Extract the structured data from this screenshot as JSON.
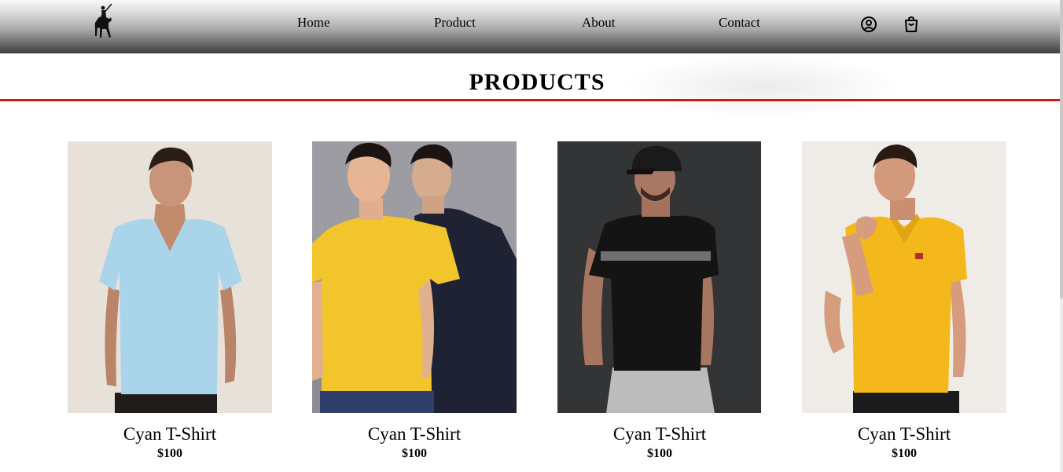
{
  "header": {
    "nav": {
      "home": "Home",
      "product": "Product",
      "about": "About",
      "contact": "Contact"
    },
    "icons": [
      "polo-horse-logo",
      "user-icon",
      "shopping-bag-icon"
    ]
  },
  "main": {
    "title": "PRODUCTS",
    "accent_color": "#d51414",
    "products": [
      {
        "name": "Cyan T-Shirt",
        "price": "$100",
        "image": "man-light-blue-v-neck-tshirt"
      },
      {
        "name": "Cyan T-Shirt",
        "price": "$100",
        "image": "two-men-yellow-and-navy-tshirts"
      },
      {
        "name": "Cyan T-Shirt",
        "price": "$100",
        "image": "man-black-tshirt-cap"
      },
      {
        "name": "Cyan T-Shirt",
        "price": "$100",
        "image": "man-yellow-polo-shirt"
      }
    ]
  }
}
